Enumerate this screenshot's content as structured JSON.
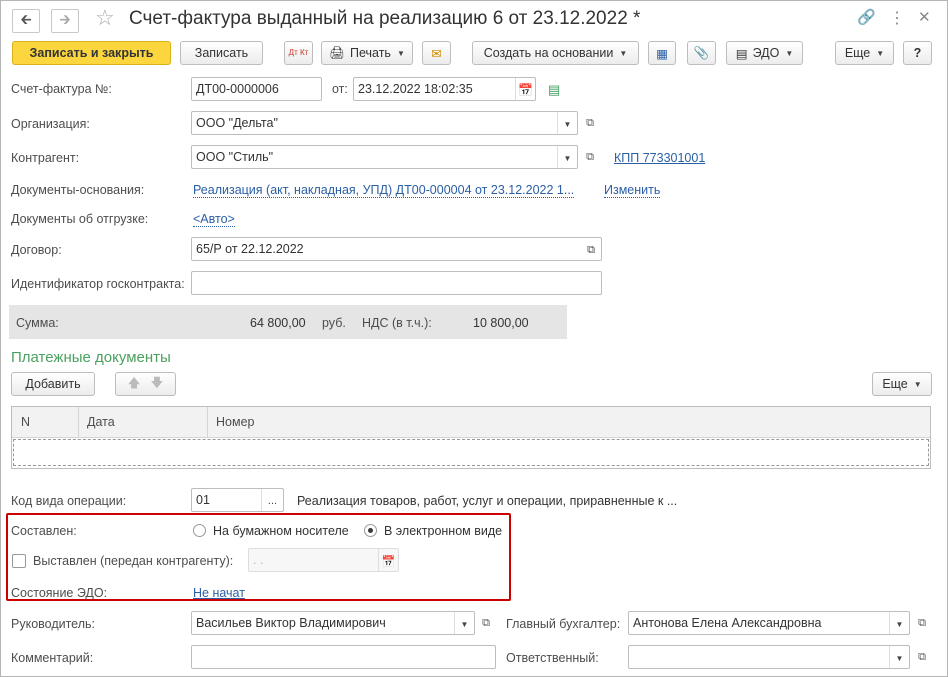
{
  "window": {
    "title": "Счет-фактура выданный на реализацию 6 от 23.12.2022 *"
  },
  "toolbar": {
    "save_close": "Записать и закрыть",
    "save": "Записать",
    "dt_kt": "Дт Кт",
    "print": "Печать",
    "create_based": "Создать на основании",
    "edo": "ЭДО",
    "more": "Еще",
    "help": "?"
  },
  "form": {
    "invoice_label": "Счет-фактура №:",
    "invoice_number": "ДТ00-0000006",
    "from_label": "от:",
    "date": "23.12.2022 18:02:35",
    "org_label": "Организация:",
    "org_value": "ООО \"Дельта\"",
    "contractor_label": "Контрагент:",
    "contractor_value": "ООО \"Стиль\"",
    "kpp_link": "КПП 773301001",
    "basis_label": "Документы-основания:",
    "basis_link": "Реализация (акт, накладная, УПД) ДТ00-000004 от 23.12.2022 1...",
    "change_link": "Изменить",
    "shipment_label": "Документы об отгрузке:",
    "shipment_link": "<Авто>",
    "contract_label": "Договор:",
    "contract_value": "65/Р от 22.12.2022",
    "gov_label": "Идентификатор госконтракта:",
    "gov_value": "",
    "sum_label": "Сумма:",
    "sum_value": "64 800,00",
    "currency": "руб.",
    "vat_label": "НДС (в т.ч.):",
    "vat_value": "10 800,00"
  },
  "payments": {
    "title": "Платежные документы",
    "add": "Добавить",
    "more": "Еще",
    "columns": [
      "N",
      "Дата",
      "Номер"
    ]
  },
  "operation": {
    "label": "Код вида операции:",
    "code": "01",
    "ellipsis": "...",
    "description": "Реализация товаров, работ, услуг и операции, приравненные к ..."
  },
  "compiled": {
    "label": "Составлен:",
    "paper": "На бумажном носителе",
    "electronic": "В электронном виде",
    "issued_label": "Выставлен (передан контрагенту):",
    "issued_date": " .  .",
    "edo_state_label": "Состояние ЭДО:",
    "edo_state": "Не начат"
  },
  "footer": {
    "head_label": "Руководитель:",
    "head_value": "Васильев Виктор Владимирович",
    "accountant_label": "Главный бухгалтер:",
    "accountant_value": "Антонова Елена Александровна",
    "comment_label": "Комментарий:",
    "comment_value": "",
    "responsible_label": "Ответственный:",
    "responsible_value": ""
  }
}
